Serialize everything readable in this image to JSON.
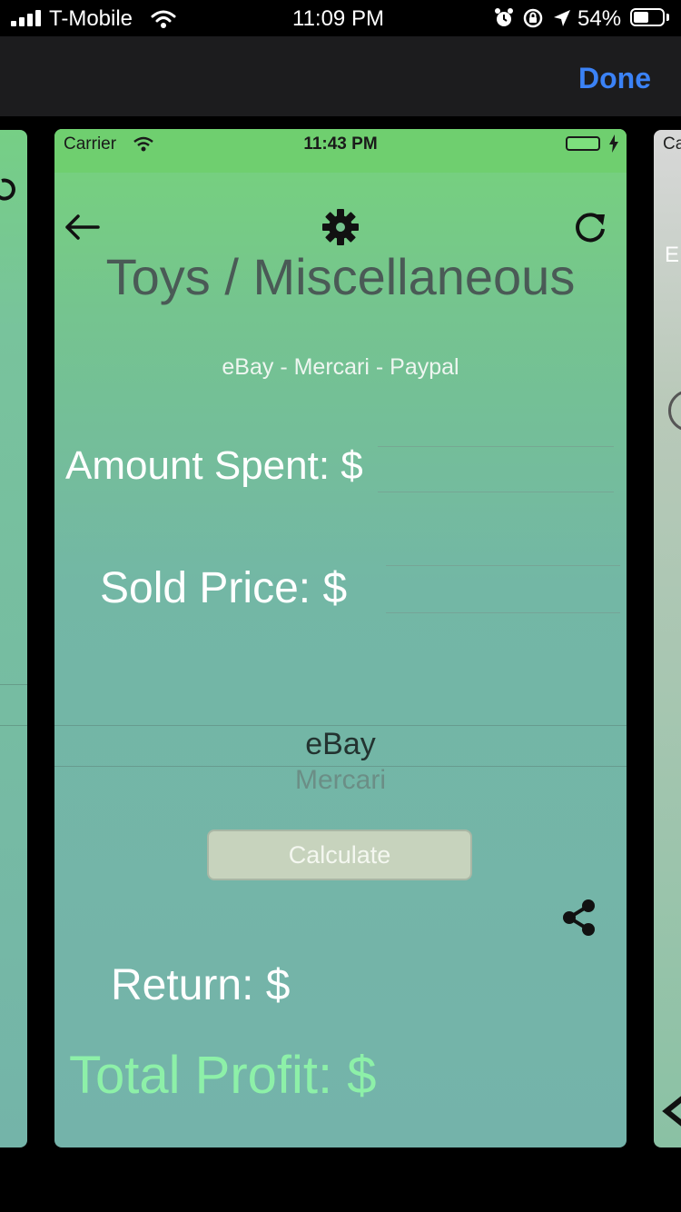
{
  "status_bar": {
    "carrier": "T-Mobile",
    "time": "11:09 PM",
    "battery": "54%",
    "battery_level": 0.54
  },
  "nav": {
    "done_label": "Done"
  },
  "card": {
    "status": {
      "carrier": "Carrier",
      "time": "11:43 PM"
    },
    "title": "Toys / Miscellaneous",
    "subtitle": "eBay - Mercari - Paypal",
    "amount_spent_label": "Amount Spent: $",
    "amount_spent_value": "",
    "sold_price_label": "Sold Price: $",
    "sold_price_value": "",
    "picker": {
      "selected": "eBay",
      "next": "Mercari"
    },
    "calculate_label": "Calculate",
    "return_label": "Return: $",
    "total_profit_label": "Total Profit: $"
  },
  "side_cards": {
    "right_peek_top": "Ca",
    "right_peek_mid": "E"
  },
  "icons": {
    "back": "arrow-left-icon",
    "settings": "gear-icon",
    "refresh": "refresh-icon",
    "share": "share-icon"
  },
  "colors": {
    "done": "#3b82f6",
    "total_profit": "#8df0a8"
  }
}
